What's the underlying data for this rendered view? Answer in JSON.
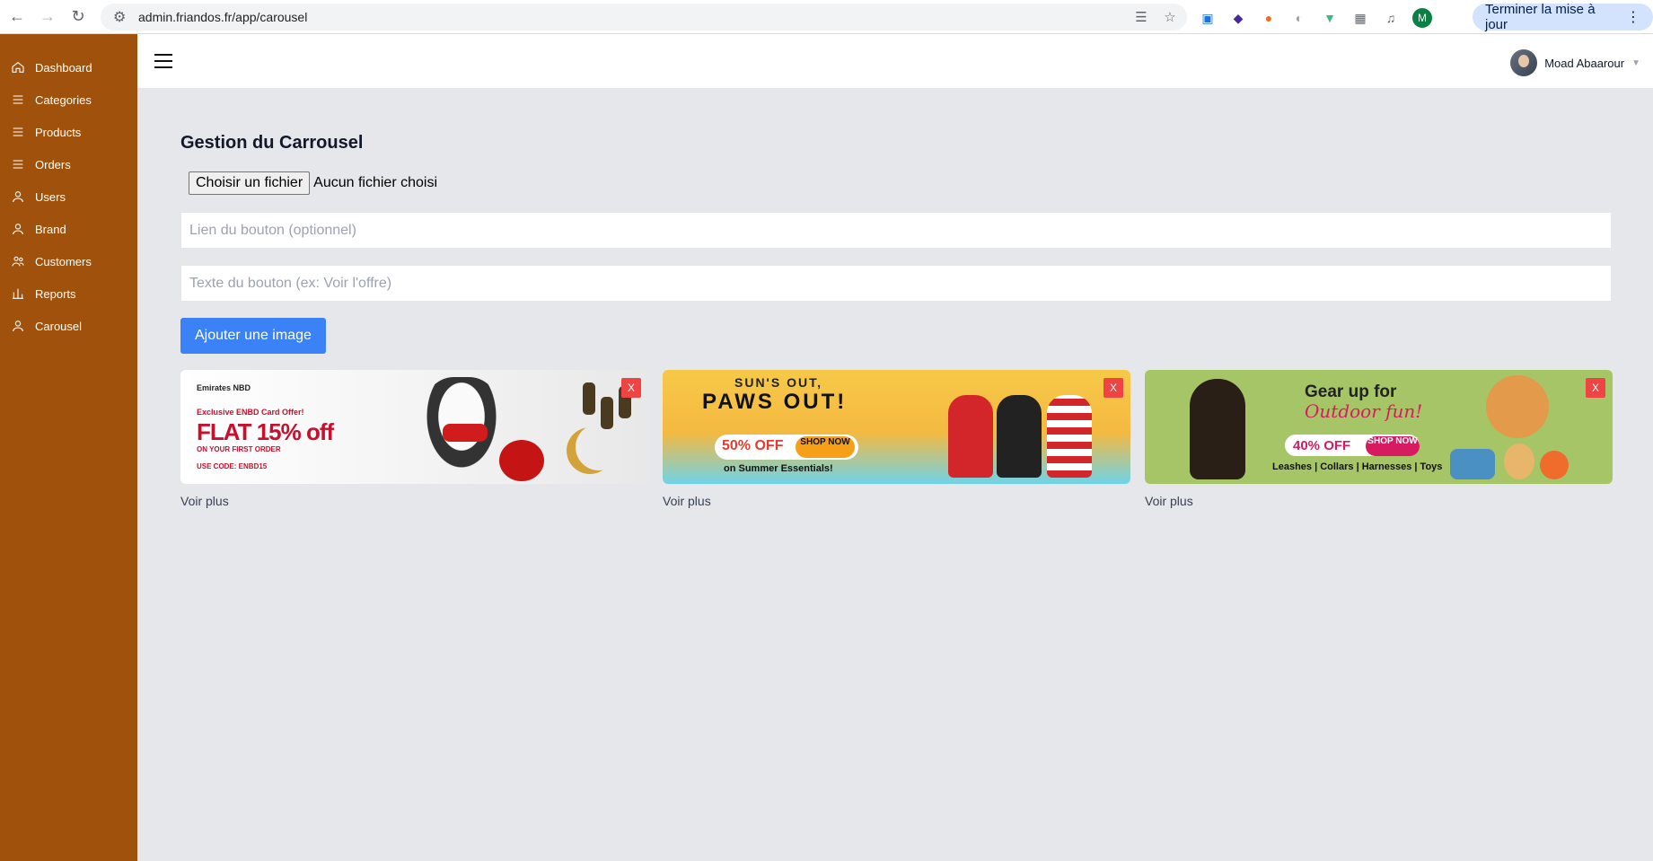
{
  "browser": {
    "url": "admin.friandos.fr/app/carousel",
    "update_label": "Terminer la mise à jour",
    "profile_initial": "M"
  },
  "sidebar": {
    "items": [
      {
        "label": "Dashboard",
        "icon": "home-icon"
      },
      {
        "label": "Categories",
        "icon": "list-icon"
      },
      {
        "label": "Products",
        "icon": "list-icon"
      },
      {
        "label": "Orders",
        "icon": "list-icon"
      },
      {
        "label": "Users",
        "icon": "user-icon"
      },
      {
        "label": "Brand",
        "icon": "user-icon"
      },
      {
        "label": "Customers",
        "icon": "users-icon"
      },
      {
        "label": "Reports",
        "icon": "bar-chart-icon"
      },
      {
        "label": "Carousel",
        "icon": "user-icon"
      }
    ],
    "bg_color": "#a0520c"
  },
  "header": {
    "user_name": "Moad Abaarour"
  },
  "main": {
    "title": "Gestion du Carrousel",
    "file_button": "Choisir un fichier",
    "file_status": "Aucun fichier choisi",
    "link_placeholder": "Lien du bouton (optionnel)",
    "text_placeholder": "Texte du bouton (ex: Voir l'offre)",
    "add_button": "Ajouter une image",
    "delete_label": "X",
    "cards": [
      {
        "caption": "Voir plus",
        "banner": {
          "logo": "Emirates NBD",
          "tagline": "Exclusive ENBD Card Offer!",
          "headline": "FLAT 15% off",
          "subline": "ON YOUR FIRST ORDER",
          "code": "USE CODE: ENBD15"
        }
      },
      {
        "caption": "Voir plus",
        "banner": {
          "line1": "SUN'S OUT,",
          "line2": "PAWS OUT!",
          "offer": "50% OFF",
          "shop": "SHOP NOW",
          "footer": "on Summer Essentials!"
        }
      },
      {
        "caption": "Voir plus",
        "banner": {
          "line1": "Gear up for",
          "line2": "Outdoor fun!",
          "offer": "40% OFF",
          "shop": "SHOP NOW",
          "footer": "Leashes | Collars | Harnesses | Toys"
        }
      }
    ],
    "accent_color": "#3b82f6",
    "danger_color": "#ef4444"
  }
}
